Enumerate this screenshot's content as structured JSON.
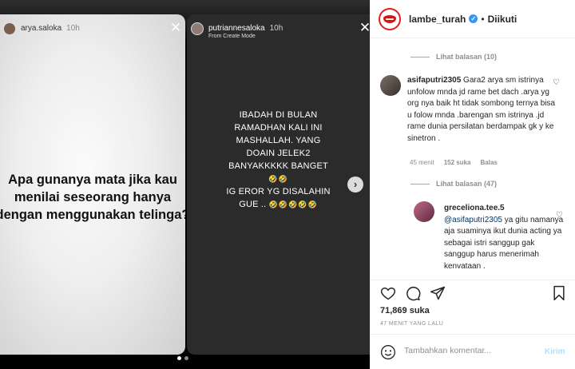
{
  "stories": {
    "left": {
      "username": "arya.saloka",
      "time": "10h",
      "text": "Apa gunanya mata jika kau menilai seseorang hanya dengan menggunakan telinga?"
    },
    "right": {
      "username": "putriannesaloka",
      "time": "10h",
      "subtitle": "From Create Mode",
      "lines": [
        "IBADAH DI BULAN",
        "RAMADHAN KALI INI",
        "MASHALLAH. YANG",
        "DOAIN JELEK2",
        "BANYAKKKKK BANGET"
      ],
      "emoji_line1": "🤣🤣",
      "line_after": "IG EROR YG DISALAHIN",
      "line_last": "GUE ..",
      "emoji_line2": "🤣🤣🤣🤣🤣"
    },
    "close_icon": "close-icon",
    "next_icon": "chevron-right-icon"
  },
  "post": {
    "owner": "lambe_turah",
    "follow_status": "Diikuti",
    "comments": {
      "view_replies_1": "Lihat balasan (10)",
      "c1_user": "asifaputri2305",
      "c1_text": "Gara2 arya sm istrinya unfolow mnda jd rame bet dach .arya yg org nya baik ht tidak sombong ternya bisa u folow mnda .barengan sm istrinya .jd rame dunia persilatan berdampak gk y ke sinetron .",
      "c1_time": "45 menit",
      "c1_likes": "152 suka",
      "c1_reply": "Balas",
      "view_replies_2": "Lihat balasan (47)",
      "c2_user": "greceliona.tee.5",
      "c2_mention": "@asifaputri2305",
      "c2_text": "ya gitu namanya aja suaminya ikut dunia acting ya sebagai istri sanggup gak sanggup harus menerimah kenvataan ."
    },
    "likes": "71,869 suka",
    "time_ago": "47 MENIT YANG LALU",
    "comment_placeholder": "Tambahkan komentar...",
    "post_button": "Kirim"
  },
  "colors": {
    "brand_red": "#d51515",
    "verified_blue": "#3897f0",
    "link_blue": "#00376b"
  }
}
